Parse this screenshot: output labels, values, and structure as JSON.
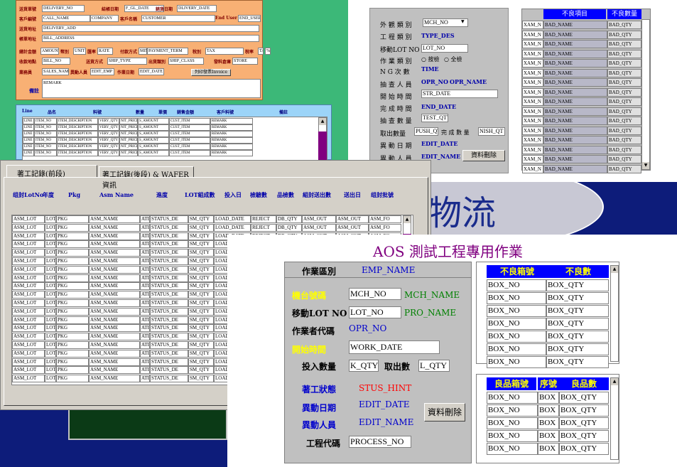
{
  "w1": {
    "r1": [
      {
        "l": "送貨單號",
        "v": "DELIVERY_NO"
      },
      {
        "l": "結帳日期",
        "v": "F_GL_DATE"
      },
      {
        "l": "銷貨日期",
        "v": "DLIVERY_DATE"
      }
    ],
    "r2": [
      {
        "l": "客戶編號",
        "v": "CALL_NAME"
      },
      {
        "l": "",
        "v": "COMPANY"
      },
      {
        "l": "客戶名稱",
        "v": "CUSTOMER"
      },
      {
        "l": "End User",
        "v": "END_USER"
      }
    ],
    "addr": [
      {
        "l": "送貨地址",
        "v": "DELIVERY_ADD"
      },
      {
        "l": "帳單地址",
        "v": "BILL_ADDRESS"
      }
    ],
    "r5": [
      {
        "l": "總計金額",
        "v": "AMOUNT"
      },
      {
        "l": "幣別",
        "v": "UNIT"
      },
      {
        "l": "匯率",
        "v": "RATE"
      },
      {
        "l": "付款方式",
        "v": "MIN"
      },
      {
        "l": "",
        "v": "PAYMENT_TERM"
      },
      {
        "l": "稅別",
        "v": "TAX"
      },
      {
        "l": "稅率",
        "v": "TAX"
      },
      {
        "l": "",
        "v": "%"
      }
    ],
    "r6": [
      {
        "l": "收款地點",
        "v": "BILL_NO"
      },
      {
        "l": "送貨方式",
        "v": "SHIP_TYPE"
      },
      {
        "l": "出貨類別",
        "v": "SHIP_CLASS"
      },
      {
        "l": "發料倉庫",
        "v": "STORE"
      }
    ],
    "r7": [
      {
        "l": "業務員",
        "v": "SALES_NAM"
      },
      {
        "l": "異動人員",
        "v": "EDIT_EMP"
      },
      {
        "l": "作業日期",
        "v": "EDIT_DATE"
      }
    ],
    "invoice_btn": "列印發票Invoice",
    "remark_label": "備註",
    "remark": "REMARK",
    "grid_headers": [
      "Line",
      "品名",
      "料號",
      "數量",
      "單價",
      "銷售金額",
      "客戶料號",
      "備註"
    ],
    "grid_row": [
      "LINE",
      "ITEM_NO",
      "ITEM_DESCRIPTION",
      "VERY_QTY",
      "NIT_PRICE",
      "S_AMOUNT",
      "CUST_ITEM",
      "REMARK"
    ]
  },
  "w2": {
    "labels": [
      "外 觀 類 別",
      "工 程 類 別",
      "移動LOT NO",
      "作 業 類 別",
      "N G 次 數",
      "抽 查 人 員",
      "開 始 時 間",
      "完 成 時 間",
      "抽 查 數 量",
      "取出數量",
      "異 動 日 期",
      "異 動 人 員"
    ],
    "mch": "MCH_NO",
    "type_des": "TYPE_DES",
    "lot": "LOT_NO",
    "opt1": "按檢",
    "opt2": "全檢",
    "time": "TIME",
    "opr_no": "OPR_NO",
    "opr_name": "OPR_NAME",
    "str_date": "STR_DATE",
    "end_date": "END_DATE",
    "test_qty": "TEST_QTY",
    "push_qty": "PUSH_QT",
    "finish_label": "完 成 數 量",
    "finish_qty": "NISH_QT",
    "edit_date": "EDIT_DATE",
    "edit_name": "EDIT_NAME",
    "del_btn": "資料刪除",
    "grid_headers": [
      "不良項目",
      "不良數量"
    ],
    "grid_row": [
      "XAM_N",
      "BAD_NAME",
      "BAD_QTY"
    ]
  },
  "w3": {
    "tabs": [
      "著工記錄(前段)",
      "著工記錄(後段) & WAFER資訊"
    ],
    "headers": [
      "组封LotNo",
      "年度",
      "Pkg",
      "Asm Name",
      "進度",
      "LOT組成數",
      "投入日",
      "檢驗數",
      "品檢數",
      "組封送出數",
      "送出日",
      "组封批號"
    ],
    "row": [
      "ASM_LOT",
      "LOT",
      "PKG",
      "ASM_NAME",
      "ATI",
      "STATUS_DE",
      "SM_QTY",
      "LOAD_DATE",
      "REJECT",
      "DB_QTY",
      "ASM_OUT",
      "ASM_OUT",
      "ASM_FO"
    ]
  },
  "bg": {
    "logo_text": "物流"
  },
  "w4": {
    "title": "AOS 測試工程專用作業",
    "area_label": "作業區別",
    "emp": "EMP_NAME",
    "mch_label": "機台號碼",
    "mch": "MCH_NO",
    "mch_name": "MCH_NAME",
    "lot_label": "移動LOT NO",
    "lot": "LOT_NO",
    "pro_name": "PRO_NAME",
    "opr_label": "作業者代碼",
    "opr": "OPR_NO",
    "start_label": "開始時間",
    "work_date": "WORK_DATE",
    "in_label": "投入數量",
    "in_qty": "K_QTY",
    "out_label": "取出數",
    "out_qty": "L_QTY",
    "status_label": "著工狀態",
    "status": "STUS_HINT",
    "edit_date_label": "異動日期",
    "edit_date": "EDIT_DATE",
    "edit_name_label": "異動人員",
    "edit_name": "EDIT_NAME",
    "del_btn": "資料刪除",
    "proc_label": "工程代碼",
    "proc": "PROCESS_NO",
    "bad_headers": [
      "不良箱號",
      "不良數"
    ],
    "bad_row": [
      "BOX_NO",
      "BOX_QTY"
    ],
    "good_headers": [
      "良品箱號",
      "序號",
      "良品數"
    ],
    "good_row": [
      "BOX_NO",
      "BOX",
      "BOX_QTY"
    ]
  },
  "colors": {
    "accent_red": "#ff0000",
    "accent_yellow": "#ffff00"
  }
}
